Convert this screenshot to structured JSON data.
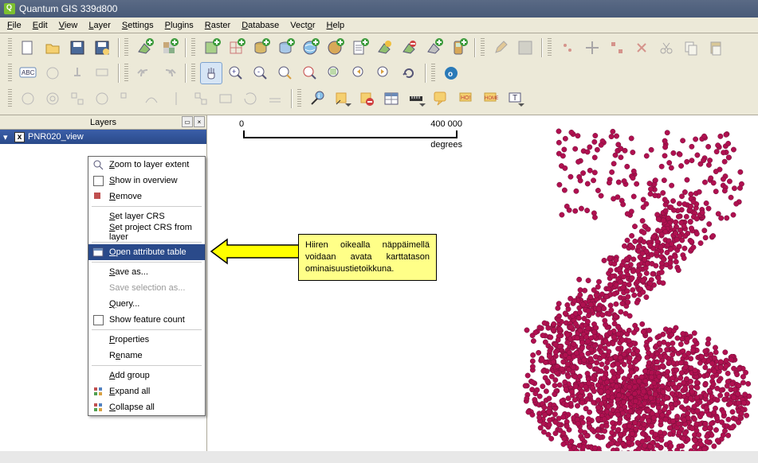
{
  "window": {
    "title": "Quantum GIS 339d800"
  },
  "menu": {
    "file": "File",
    "edit": "Edit",
    "view": "View",
    "layer": "Layer",
    "settings": "Settings",
    "plugins": "Plugins",
    "raster": "Raster",
    "database": "Database",
    "vector": "Vector",
    "help": "Help"
  },
  "layers_panel": {
    "title": "Layers",
    "layer_name": "PNR020_view"
  },
  "scale": {
    "start": "0",
    "end": "400 000",
    "unit": "degrees"
  },
  "context_menu": {
    "zoom_extent": "Zoom to layer extent",
    "show_overview": "Show in overview",
    "remove": "Remove",
    "set_layer_crs": "Set layer CRS",
    "set_project_crs": "Set project CRS from layer",
    "open_attr_table": "Open attribute table",
    "save_as": "Save as...",
    "save_sel_as": "Save selection as...",
    "query": "Query...",
    "show_feature_count": "Show feature count",
    "properties": "Properties",
    "rename": "Rename",
    "add_group": "Add group",
    "expand_all": "Expand all",
    "collapse_all": "Collapse all"
  },
  "callout": {
    "text": "Hiiren oikealla näppäimellä voidaan avata karttatason ominaisuustietoikkuna."
  }
}
